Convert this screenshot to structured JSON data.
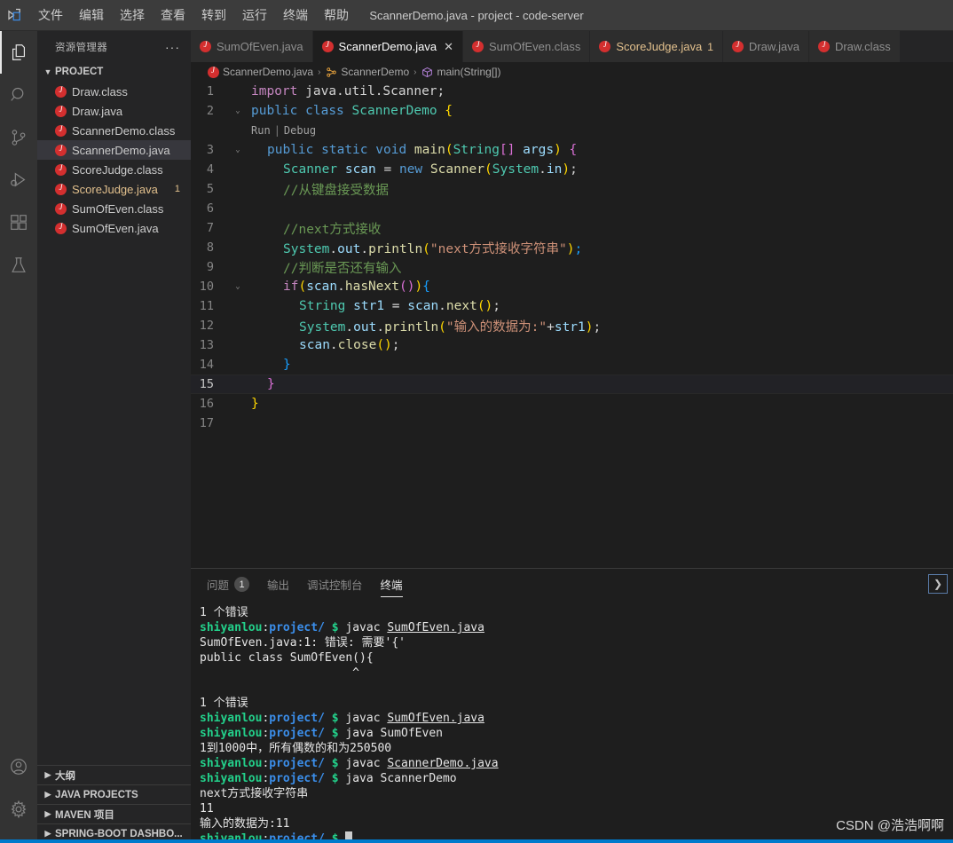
{
  "titlebar": {
    "logo_icon": "vscode-logo-icon",
    "window_title": "ScannerDemo.java - project - code-server",
    "menus": [
      {
        "label": "文件"
      },
      {
        "label": "编辑"
      },
      {
        "label": "选择"
      },
      {
        "label": "查看"
      },
      {
        "label": "转到"
      },
      {
        "label": "运行"
      },
      {
        "label": "终端"
      },
      {
        "label": "帮助"
      }
    ]
  },
  "activitybar": {
    "items": [
      {
        "name": "explorer-icon",
        "active": true
      },
      {
        "name": "search-icon",
        "active": false
      },
      {
        "name": "source-control-icon",
        "active": false
      },
      {
        "name": "run-and-debug-icon",
        "active": false
      },
      {
        "name": "extensions-icon",
        "active": false
      },
      {
        "name": "testing-flask-icon",
        "active": false
      }
    ],
    "bottom": [
      {
        "name": "account-icon"
      },
      {
        "name": "settings-gear-icon"
      }
    ]
  },
  "sidebar": {
    "title": "资源管理器",
    "more_label": "···",
    "project": {
      "label": "PROJECT",
      "expanded": true
    },
    "files": [
      {
        "name": "Draw.class",
        "selected": false,
        "warn": false,
        "badge": ""
      },
      {
        "name": "Draw.java",
        "selected": false,
        "warn": false,
        "badge": ""
      },
      {
        "name": "ScannerDemo.class",
        "selected": false,
        "warn": false,
        "badge": ""
      },
      {
        "name": "ScannerDemo.java",
        "selected": true,
        "warn": false,
        "badge": ""
      },
      {
        "name": "ScoreJudge.class",
        "selected": false,
        "warn": false,
        "badge": ""
      },
      {
        "name": "ScoreJudge.java",
        "selected": false,
        "warn": true,
        "badge": "1"
      },
      {
        "name": "SumOfEven.class",
        "selected": false,
        "warn": false,
        "badge": ""
      },
      {
        "name": "SumOfEven.java",
        "selected": false,
        "warn": false,
        "badge": ""
      }
    ],
    "bottom_panes": [
      {
        "label": "大纲"
      },
      {
        "label": "JAVA PROJECTS"
      },
      {
        "label": "MAVEN 项目"
      },
      {
        "label": "SPRING-BOOT DASHBO..."
      }
    ]
  },
  "tabs": [
    {
      "label": "SumOfEven.java",
      "active": false,
      "warn": false,
      "badge": "",
      "closable": false
    },
    {
      "label": "ScannerDemo.java",
      "active": true,
      "warn": false,
      "badge": "",
      "closable": true
    },
    {
      "label": "SumOfEven.class",
      "active": false,
      "warn": false,
      "badge": "",
      "closable": false
    },
    {
      "label": "ScoreJudge.java",
      "active": false,
      "warn": true,
      "badge": "1",
      "closable": false
    },
    {
      "label": "Draw.java",
      "active": false,
      "warn": false,
      "badge": "",
      "closable": false
    },
    {
      "label": "Draw.class",
      "active": false,
      "warn": false,
      "badge": "",
      "closable": false
    }
  ],
  "breadcrumb": {
    "items": [
      {
        "label": "ScannerDemo.java",
        "icon": "java-file-icon"
      },
      {
        "label": "ScannerDemo",
        "icon": "class-icon"
      },
      {
        "label": "main(String[])",
        "icon": "method-icon"
      }
    ],
    "separator": "›"
  },
  "editor": {
    "codelens": {
      "run": "Run",
      "separator": "|",
      "debug": "Debug"
    },
    "lines": [
      {
        "n": "1",
        "fold": "",
        "current": false
      },
      {
        "n": "2",
        "fold": "⌄",
        "current": false
      },
      {
        "n": "3",
        "fold": "⌄",
        "current": false
      },
      {
        "n": "4",
        "fold": "",
        "current": false
      },
      {
        "n": "5",
        "fold": "",
        "current": false
      },
      {
        "n": "6",
        "fold": "",
        "current": false
      },
      {
        "n": "7",
        "fold": "",
        "current": false
      },
      {
        "n": "8",
        "fold": "",
        "current": false
      },
      {
        "n": "9",
        "fold": "",
        "current": false
      },
      {
        "n": "10",
        "fold": "⌄",
        "current": false
      },
      {
        "n": "11",
        "fold": "",
        "current": false
      },
      {
        "n": "12",
        "fold": "",
        "current": false
      },
      {
        "n": "13",
        "fold": "",
        "current": false
      },
      {
        "n": "14",
        "fold": "",
        "current": false
      },
      {
        "n": "15",
        "fold": "",
        "current": true
      },
      {
        "n": "16",
        "fold": "",
        "current": false
      },
      {
        "n": "17",
        "fold": "",
        "current": false
      }
    ],
    "source_text": [
      "import java.util.Scanner;",
      "public class ScannerDemo {",
      "    public static void main(String[] args) {",
      "        Scanner scan = new Scanner(System.in);",
      "        //从键盘接受数据",
      "",
      "        //next方式接收",
      "        System.out.println(\"next方式接收字符串\");",
      "        //判断是否还有输入",
      "        if(scan.hasNext()){",
      "            String str1 = scan.next();",
      "            System.out.println(\"输入的数据为:\"+str1);",
      "            scan.close();",
      "        }",
      "    }",
      "}",
      ""
    ]
  },
  "panel": {
    "tabs": [
      {
        "label": "问题",
        "badge": "1",
        "active": false
      },
      {
        "label": "输出",
        "badge": "",
        "active": false
      },
      {
        "label": "调试控制台",
        "badge": "",
        "active": false
      },
      {
        "label": "终端",
        "badge": "",
        "active": true
      }
    ],
    "action_icon": "chevron-right-icon",
    "terminal": {
      "prompt_user": "shiyanlou",
      "prompt_path": "project/",
      "prompt_dollar": "$",
      "lines": [
        {
          "type": "out",
          "text": "1 个错误"
        },
        {
          "type": "cmd",
          "cmd": "javac ",
          "arg": "SumOfEven.java",
          "underline": true
        },
        {
          "type": "out",
          "text": "SumOfEven.java:1: 错误: 需要'{'"
        },
        {
          "type": "out",
          "text": "public class SumOfEven(){"
        },
        {
          "type": "out",
          "text": "                      ^"
        },
        {
          "type": "out",
          "text": ""
        },
        {
          "type": "out",
          "text": "1 个错误"
        },
        {
          "type": "cmd",
          "cmd": "javac ",
          "arg": "SumOfEven.java",
          "underline": true
        },
        {
          "type": "cmd",
          "cmd": "java ",
          "arg": "SumOfEven",
          "underline": false
        },
        {
          "type": "out",
          "text": "1到1000中，所有偶数的和为250500"
        },
        {
          "type": "cmd",
          "cmd": "javac ",
          "arg": "ScannerDemo.java",
          "underline": true
        },
        {
          "type": "cmd",
          "cmd": "java ",
          "arg": "ScannerDemo",
          "underline": false
        },
        {
          "type": "out",
          "text": "next方式接收字符串"
        },
        {
          "type": "out",
          "text": "11"
        },
        {
          "type": "out",
          "text": "输入的数据为:11"
        },
        {
          "type": "cmd",
          "cmd": "",
          "arg": "",
          "underline": false,
          "cursor": true
        }
      ]
    }
  },
  "watermark": "CSDN @浩浩啊啊",
  "colors": {
    "accent": "#007acc",
    "java_icon": "#d32f2f",
    "warn": "#e2c08d",
    "terminal_green": "#23d18b",
    "terminal_blue": "#3b8eea"
  }
}
